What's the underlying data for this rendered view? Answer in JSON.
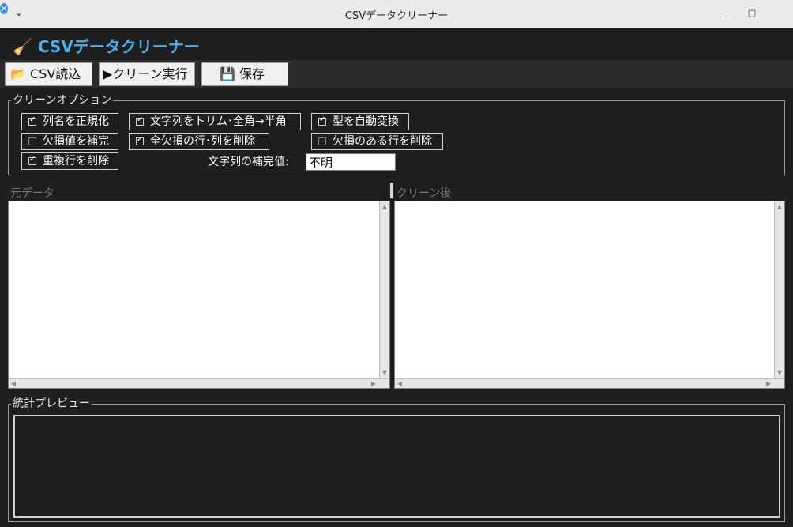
{
  "window": {
    "title": "CSVデータクリーナー",
    "menu_icon": "chevron-down",
    "minimize_icon": "minimize",
    "maximize_icon": "maximize",
    "close_icon": "close"
  },
  "header": {
    "icon": "broom",
    "title": "🧹 CSVデータクリーナー",
    "accent_color": "#46b3f0"
  },
  "toolbar": {
    "load_label": "📂 CSV読込",
    "run_label": "▶クリーン実行",
    "save_label": "💾 保存"
  },
  "options": {
    "title": "クリーンオプション",
    "normalize_columns": {
      "label": "列名を正規化",
      "checked": true
    },
    "trim_strings": {
      "label": "文字列をトリム･全角→半角",
      "checked": true
    },
    "auto_types": {
      "label": "型を自動変換",
      "checked": true
    },
    "fill_missing": {
      "label": "欠損値を補完",
      "checked": false
    },
    "drop_empty": {
      "label": "全欠損の行･列を削除",
      "checked": true
    },
    "drop_missing_rows": {
      "label": "欠損のある行を削除",
      "checked": false
    },
    "drop_duplicates": {
      "label": "重複行を削除",
      "checked": true
    },
    "fill_value_label": "文字列の補完値:",
    "fill_value": "不明"
  },
  "panes": {
    "original_label": "元データ",
    "cleaned_label": "クリーン後"
  },
  "stats": {
    "title": "統計プレビュー"
  }
}
